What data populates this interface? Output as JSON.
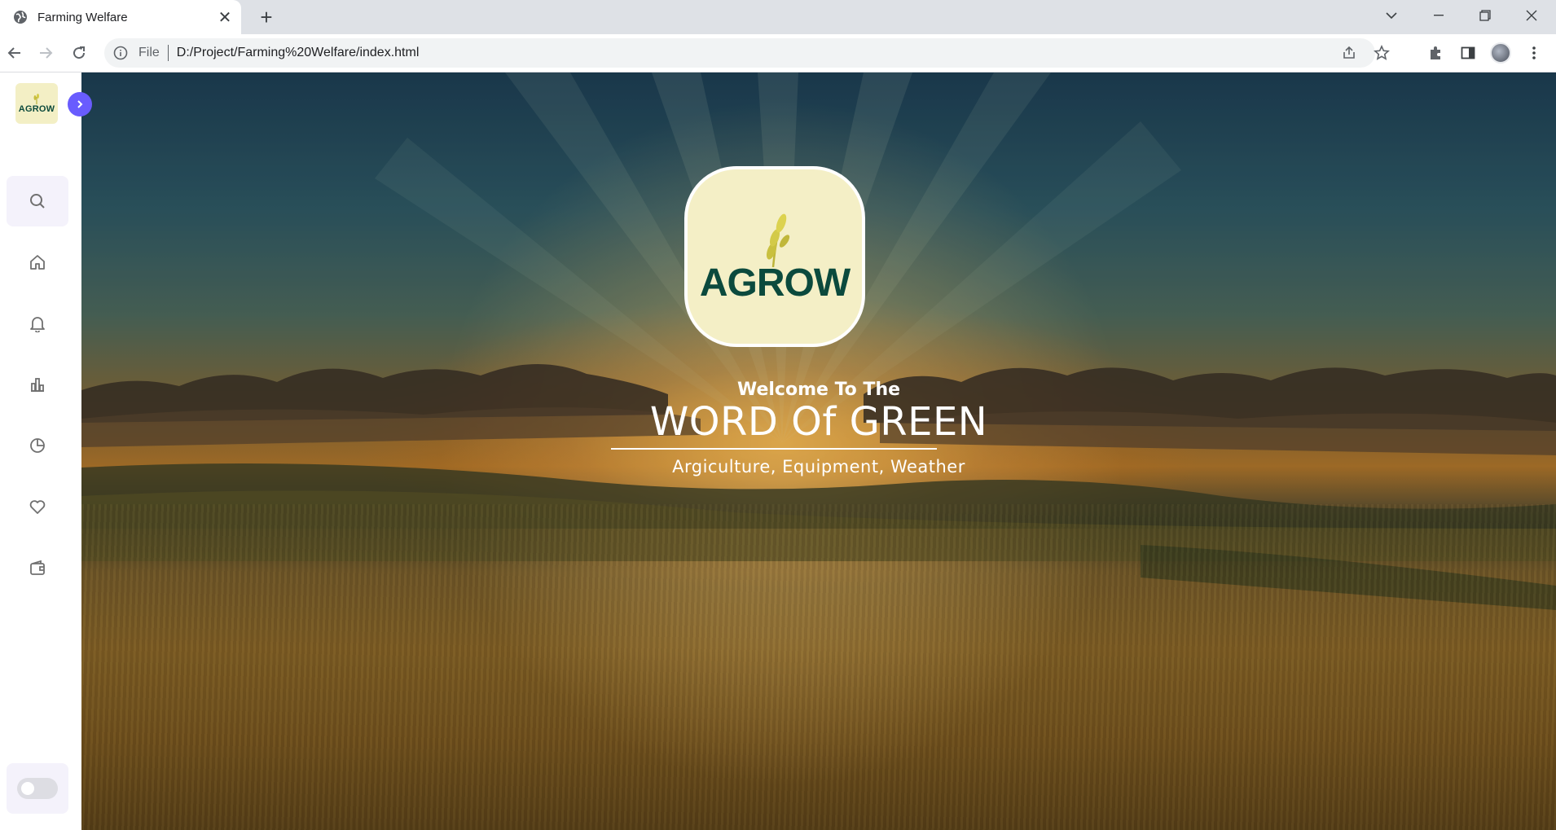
{
  "browser": {
    "tab_title": "Farming Welfare",
    "address_scheme": "File",
    "address_url": "D:/Project/Farming%20Welfare/index.html"
  },
  "sidebar": {
    "logo_text": "AGROW",
    "items": [
      {
        "name": "search",
        "icon": "search-icon"
      },
      {
        "name": "home",
        "icon": "home-icon"
      },
      {
        "name": "notifications",
        "icon": "bell-icon"
      },
      {
        "name": "analytics",
        "icon": "bar-chart-icon"
      },
      {
        "name": "history",
        "icon": "pie-chart-icon"
      },
      {
        "name": "likes",
        "icon": "heart-icon"
      },
      {
        "name": "wallet",
        "icon": "wallet-icon"
      }
    ],
    "accent_color": "#695cfe"
  },
  "hero": {
    "logo_text": "AGROW",
    "welcome": "Welcome To The",
    "headline": "WORD Of GREEN",
    "subline": "Argiculture, Equipment, Weather"
  }
}
